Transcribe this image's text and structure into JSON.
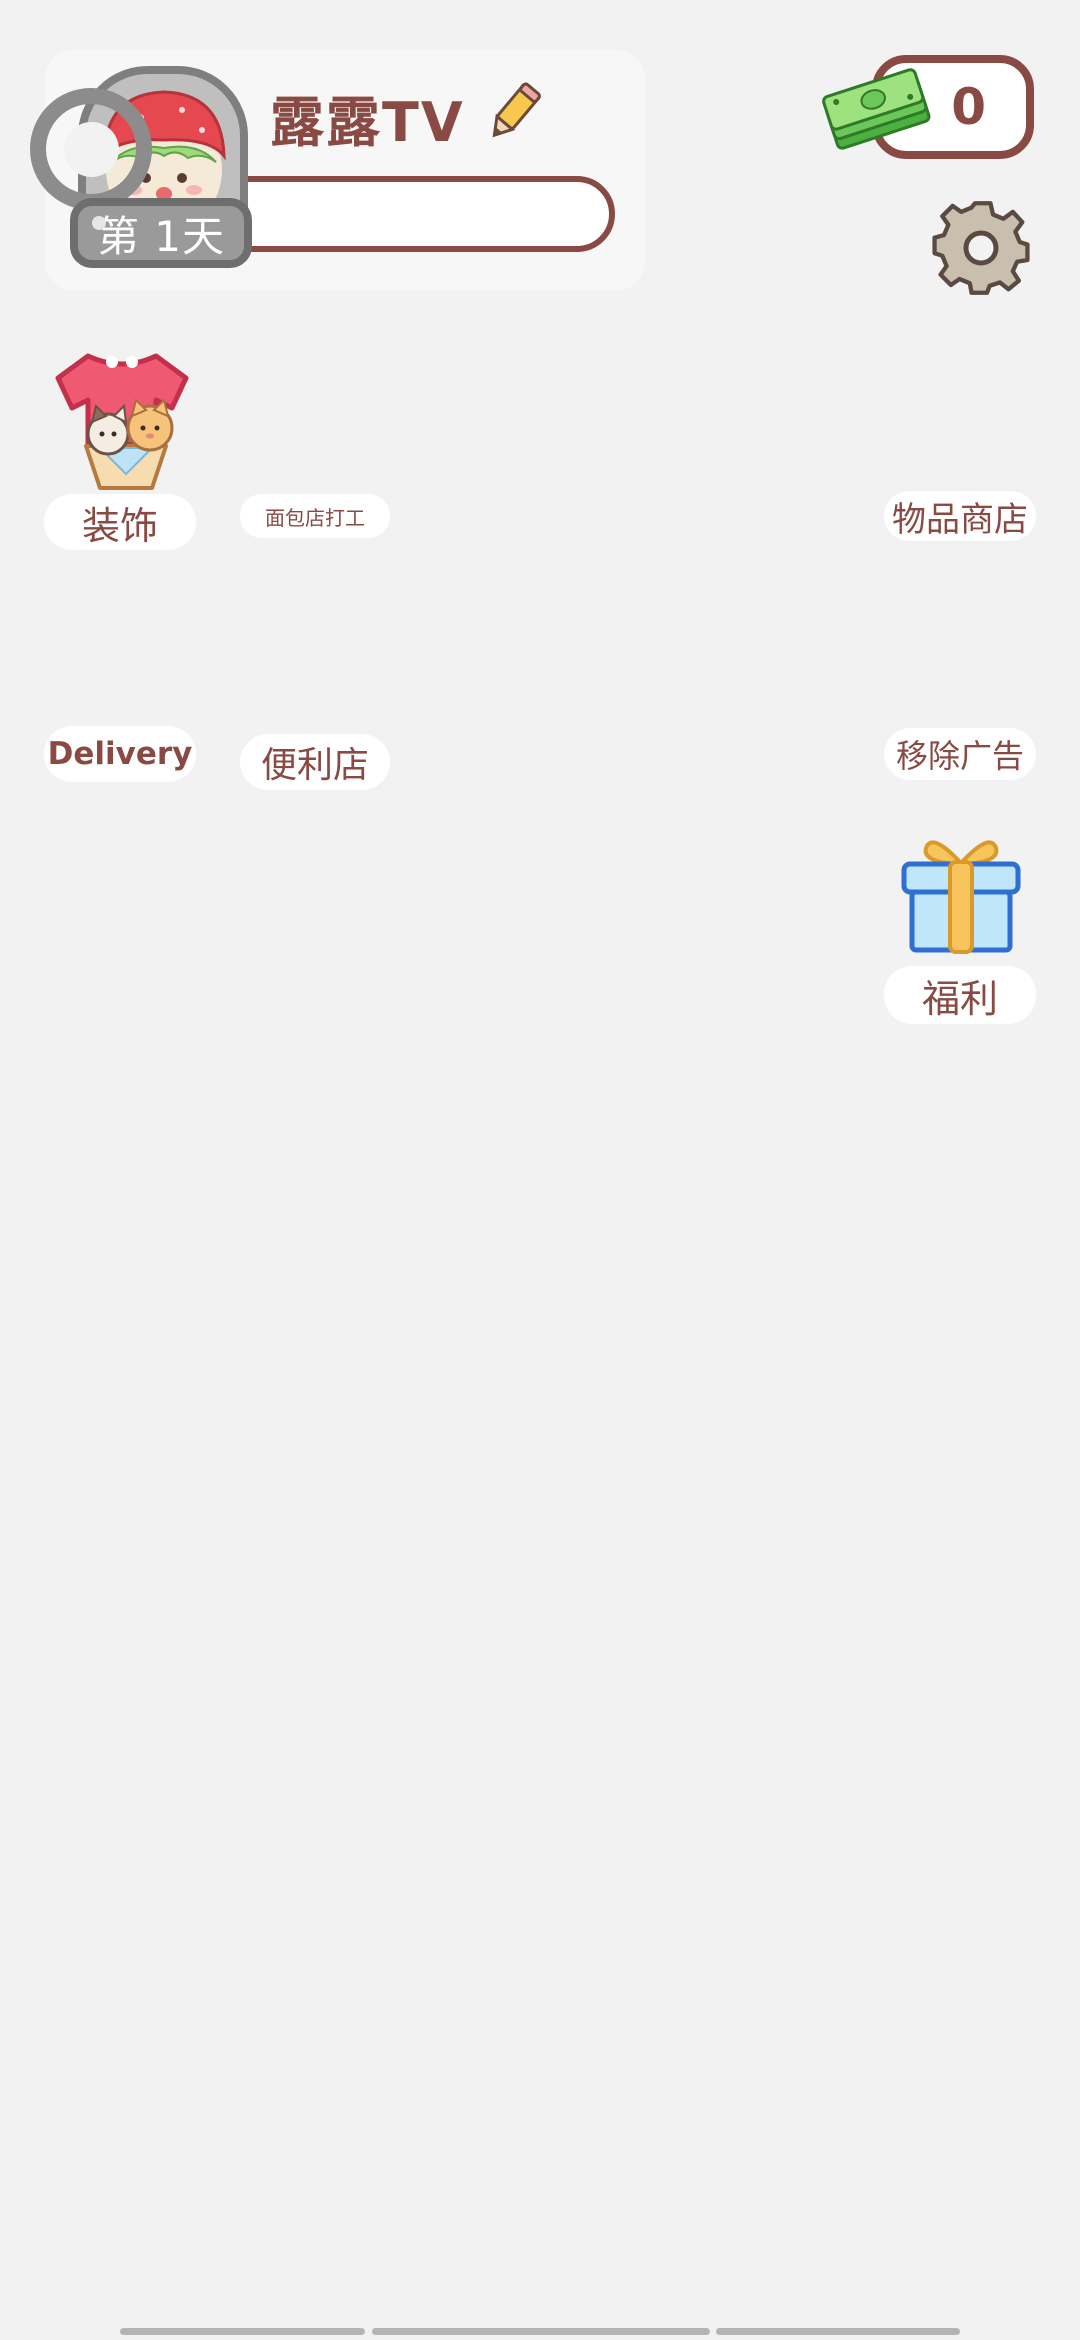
{
  "profile": {
    "username": "露露TV",
    "day_label": "第 1天"
  },
  "currency": {
    "amount": "0"
  },
  "menu": {
    "decor": "装饰",
    "bakery_job": "面包店打工",
    "item_shop": "物品商店",
    "delivery": "Delivery",
    "convenience_store": "便利店",
    "remove_ads": "移除广告",
    "welfare": "福利"
  },
  "colors": {
    "accent": "#8a4a44",
    "background": "#f2f2f2"
  },
  "icons": {
    "avatar": "strawberry-girl-avatar",
    "edit": "pencil-icon",
    "cash": "cash-stack-icon",
    "settings": "gear-icon",
    "decor": "shirt-cats-basket-icon",
    "welfare": "gift-box-icon"
  }
}
